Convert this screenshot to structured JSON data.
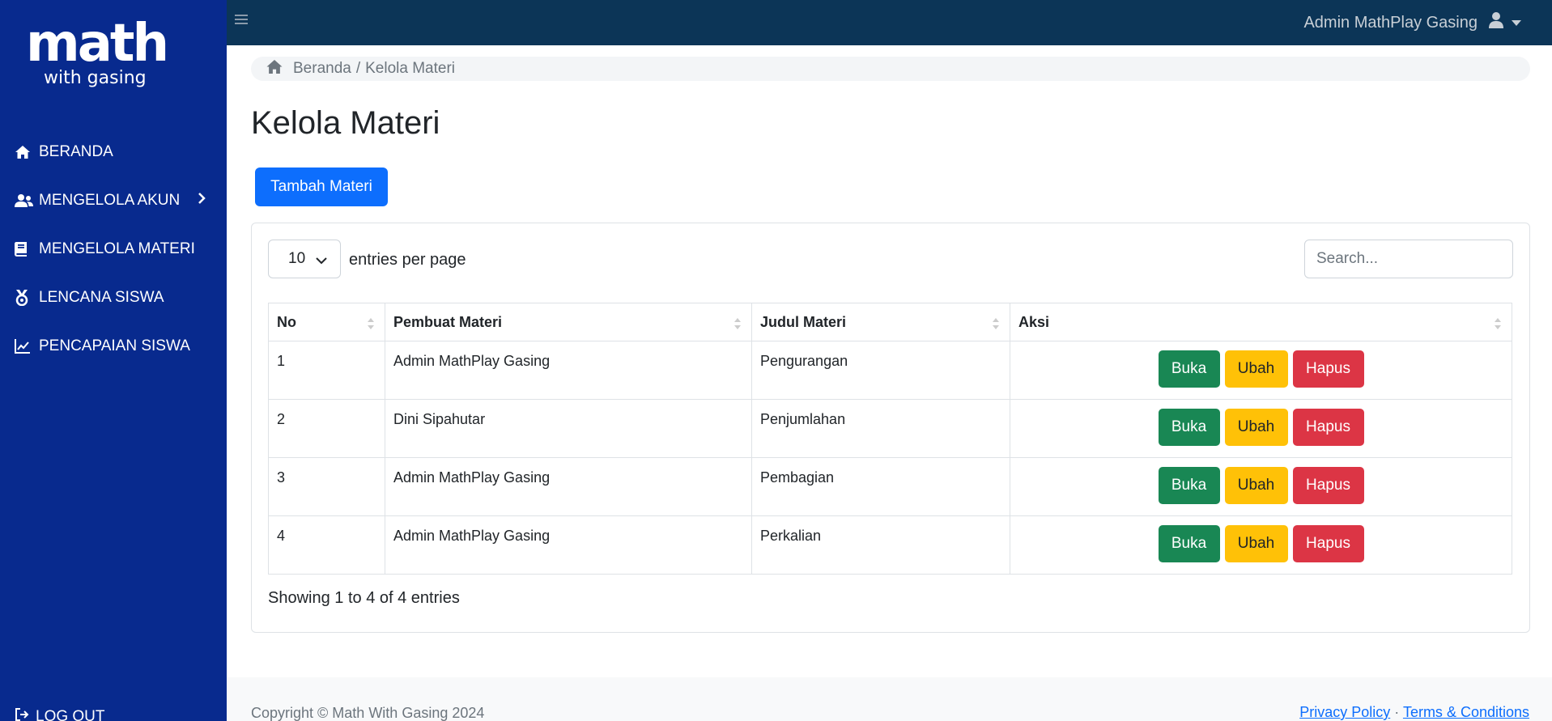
{
  "sidebar": {
    "logo_main": "math",
    "logo_sub": "with gasing",
    "items": [
      {
        "label": "BERANDA",
        "icon": "home-icon"
      },
      {
        "label": "MENGELOLA AKUN",
        "icon": "users-icon"
      },
      {
        "label": "MENGELOLA MATERI",
        "icon": "book-icon"
      },
      {
        "label": "LENCANA SISWA",
        "icon": "medal-icon"
      },
      {
        "label": "PENCAPAIAN SISWA",
        "icon": "chart-line-icon"
      }
    ],
    "logout": "LOG OUT"
  },
  "topbar": {
    "user_name": "Admin MathPlay Gasing"
  },
  "breadcrumb": {
    "home": "Beranda",
    "separator": "/",
    "current": "Kelola Materi"
  },
  "page_title": "Kelola Materi",
  "add_button": "Tambah Materi",
  "table_controls": {
    "per_page_value": "10",
    "per_page_label": "entries per page",
    "search_placeholder": "Search..."
  },
  "table": {
    "headers": [
      "No",
      "Pembuat Materi",
      "Judul Materi",
      "Aksi"
    ],
    "rows": [
      {
        "no": "1",
        "pembuat": "Admin MathPlay Gasing",
        "judul": "Pengurangan"
      },
      {
        "no": "2",
        "pembuat": "Dini Sipahutar",
        "judul": "Penjumlahan"
      },
      {
        "no": "3",
        "pembuat": "Admin MathPlay Gasing",
        "judul": "Pembagian"
      },
      {
        "no": "4",
        "pembuat": "Admin MathPlay Gasing",
        "judul": "Perkalian"
      }
    ],
    "actions": {
      "open": "Buka",
      "edit": "Ubah",
      "delete": "Hapus"
    }
  },
  "showing_text": "Showing 1 to 4 of 4 entries",
  "footer": {
    "copyright": "Copyright © Math With Gasing 2024",
    "privacy": "Privacy Policy",
    "separator": "·",
    "terms": "Terms & Conditions"
  },
  "colors": {
    "sidebar": "#082a8e",
    "topbar": "#0c3557",
    "primary": "#0d6efd",
    "success": "#198754",
    "warning": "#ffc107",
    "danger": "#dc3545"
  }
}
